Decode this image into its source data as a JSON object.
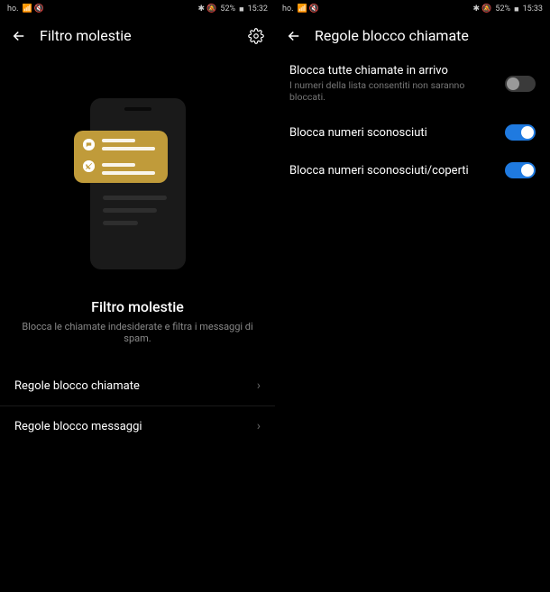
{
  "left": {
    "status": {
      "carrier": "ho.",
      "icons": "📶 🔇",
      "right_icons": "✱ 🔕",
      "battery": "52%",
      "batt_icon": "■",
      "time": "15:32"
    },
    "header": {
      "title": "Filtro molestie"
    },
    "section": {
      "title": "Filtro molestie",
      "desc": "Blocca le chiamate indesiderate e filtra i messaggi di spam."
    },
    "menu": [
      {
        "label": "Regole blocco chiamate"
      },
      {
        "label": "Regole blocco messaggi"
      }
    ]
  },
  "right": {
    "status": {
      "carrier": "ho.",
      "icons": "📶 🔇",
      "right_icons": "✱ 🔕",
      "battery": "52%",
      "batt_icon": "■",
      "time": "15:33"
    },
    "header": {
      "title": "Regole blocco chiamate"
    },
    "settings": [
      {
        "label": "Blocca tutte chiamate in arrivo",
        "sub": "I numeri della lista consentiti non saranno bloccati.",
        "on": false
      },
      {
        "label": "Blocca numeri sconosciuti",
        "sub": "",
        "on": true
      },
      {
        "label": "Blocca numeri sconosciuti/coperti",
        "sub": "",
        "on": true
      }
    ]
  }
}
